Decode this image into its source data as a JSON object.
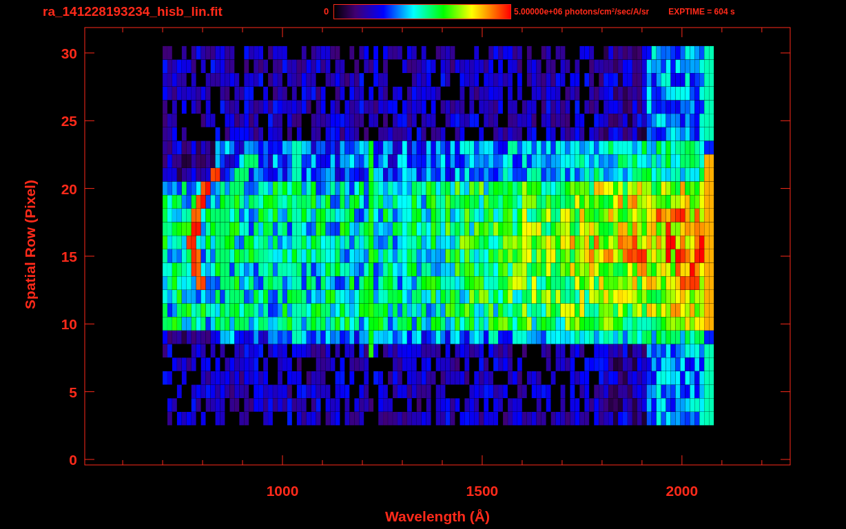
{
  "title": "ra_141228193234_hisb_lin.fit",
  "colorbar": {
    "min_label": "0",
    "max_label": "5.00000e+06 photons/cm$^{2}$/sec/A/sr"
  },
  "exptime": "EXPTIME = 604 s",
  "plot": {
    "xlabel": "Wavelength (Å)",
    "ylabel": "Spatial Row (Pixel)",
    "xticks": [
      "1000",
      "1500",
      "2000"
    ],
    "yticks": [
      "30",
      "25",
      "20",
      "15",
      "10",
      "5",
      "0"
    ]
  }
}
